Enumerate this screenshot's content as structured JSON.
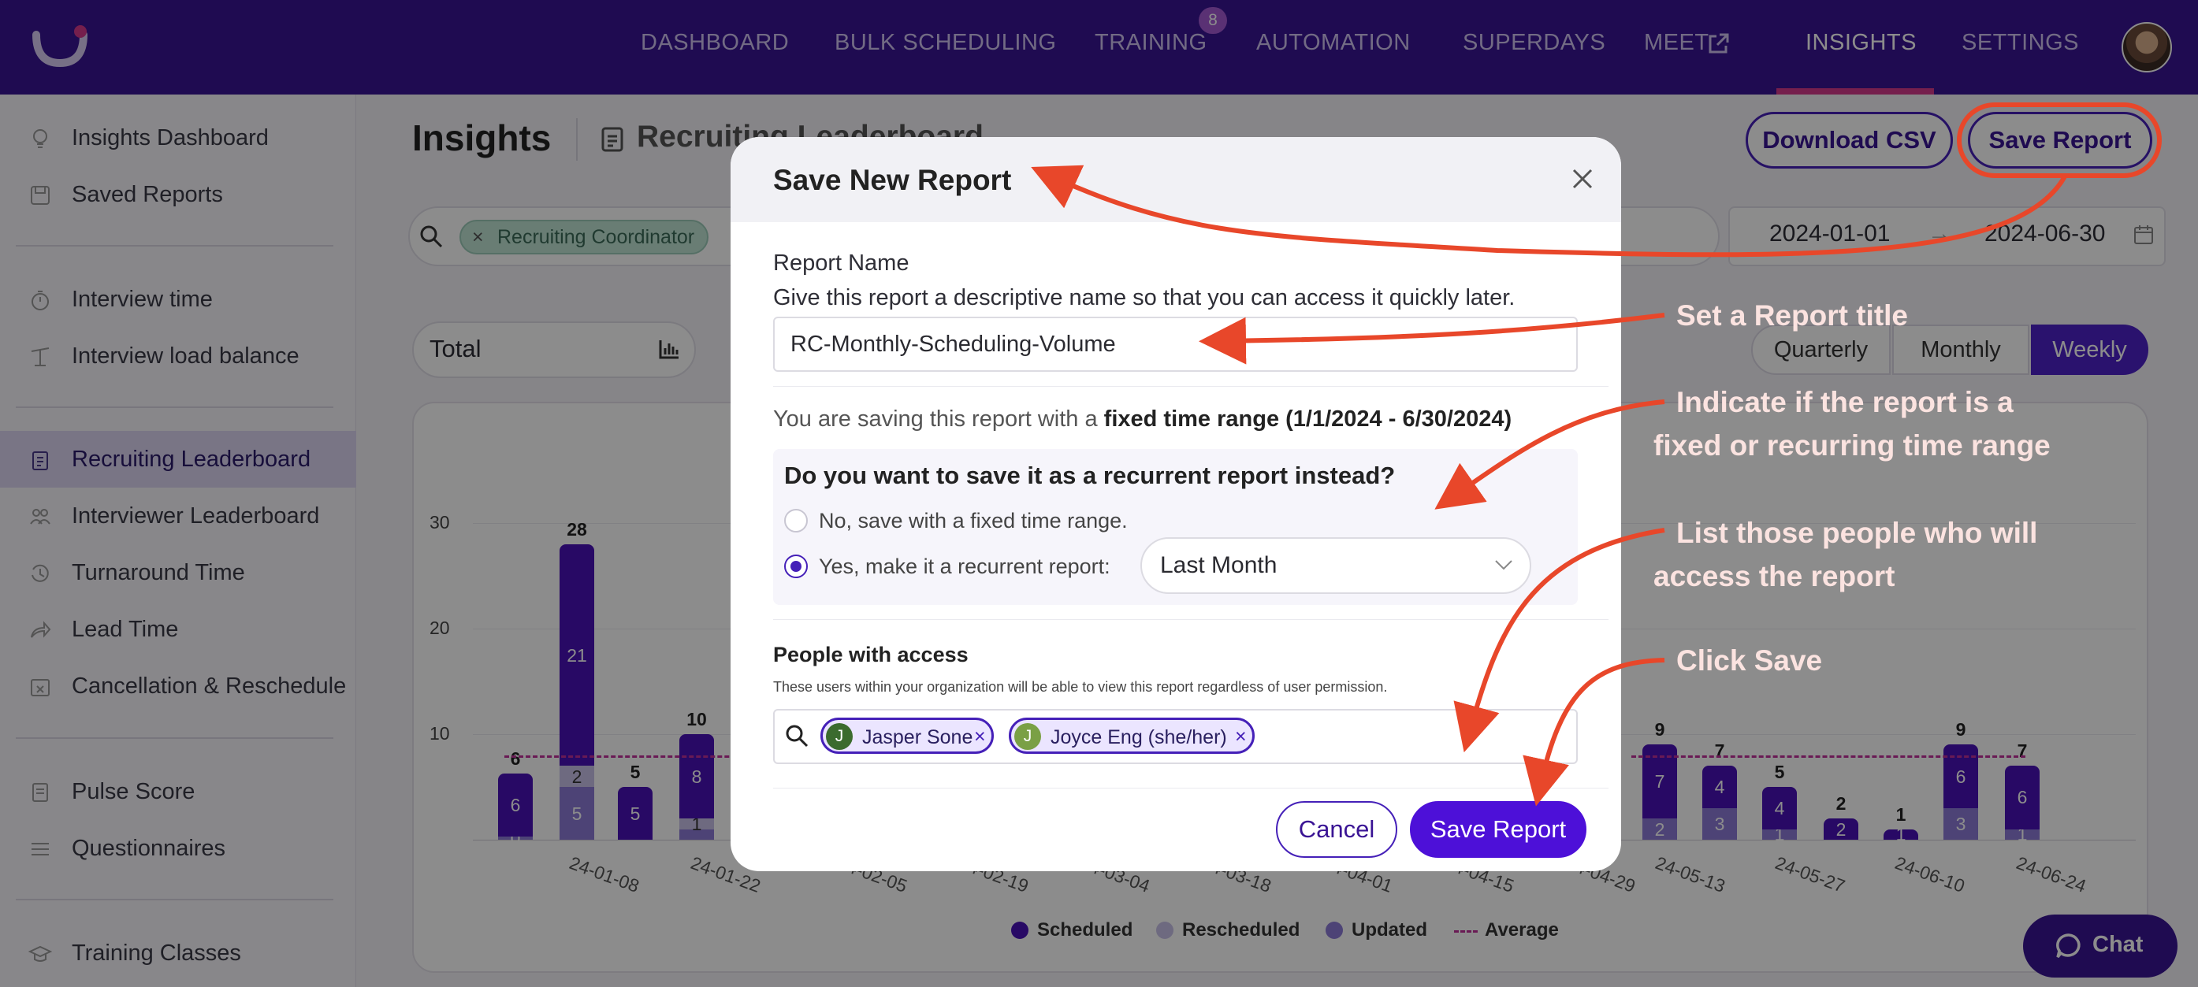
{
  "nav": {
    "items": [
      "DASHBOARD",
      "BULK SCHEDULING",
      "TRAINING",
      "AUTOMATION",
      "SUPERDAYS",
      "MEET",
      "INSIGHTS",
      "SETTINGS"
    ],
    "training_badge": "8"
  },
  "sidebar": {
    "items": [
      "Insights Dashboard",
      "Saved Reports",
      "Interview time",
      "Interview load balance",
      "Recruiting Leaderboard",
      "Interviewer Leaderboard",
      "Turnaround Time",
      "Lead Time",
      "Cancellation & Reschedule",
      "Pulse Score",
      "Questionnaires",
      "Training Classes"
    ]
  },
  "header": {
    "title": "Insights",
    "subtitle": "Recruiting Leaderboard",
    "download_csv": "Download CSV",
    "save_report": "Save Report"
  },
  "filters": {
    "chip": "Recruiting Coordinator",
    "date_start": "2024-01-01",
    "date_arrow": "→",
    "date_end": "2024-06-30"
  },
  "toolbar": {
    "total_label": "Total",
    "segments": [
      "Quarterly",
      "Monthly",
      "Weekly"
    ]
  },
  "chart_data": {
    "type": "bar",
    "stacked": true,
    "y_ticks": [
      "10",
      "20",
      "30"
    ],
    "ylim": [
      0,
      30
    ],
    "x_tick_labels": [
      "24-01-08",
      "24-01-22",
      "24-02-05",
      "24-02-19",
      "24-03-04",
      "24-03-18",
      "24-04-01",
      "24-04-15",
      "24-04-29",
      "24-05-13",
      "24-05-27",
      "24-06-10",
      "24-06-24"
    ],
    "bars": [
      {
        "total": "6",
        "segments": [
          {
            "series": "Scheduled",
            "value": 6,
            "label": "6"
          },
          {
            "series": "Updated",
            "value": 0.2,
            "label": "0"
          }
        ]
      },
      {
        "total": "28",
        "segments": [
          {
            "series": "Scheduled",
            "value": 21,
            "label": "21"
          },
          {
            "series": "Rescheduled",
            "value": 2,
            "label": "2"
          },
          {
            "series": "Updated",
            "value": 5,
            "label": "5"
          }
        ]
      },
      {
        "total": "5",
        "segments": [
          {
            "series": "Scheduled",
            "value": 5,
            "label": "5"
          }
        ]
      },
      {
        "total": "10",
        "segments": [
          {
            "series": "Scheduled",
            "value": 8,
            "label": "8"
          },
          {
            "series": "Rescheduled",
            "value": 1,
            "label": "1"
          },
          {
            "series": "Updated",
            "value": 1,
            "label": ""
          }
        ]
      },
      {
        "total": "9",
        "segments": [
          {
            "series": "Scheduled",
            "value": 7,
            "label": "7"
          },
          {
            "series": "Updated",
            "value": 2,
            "label": "2"
          }
        ]
      },
      {
        "total": "7",
        "segments": [
          {
            "series": "Scheduled",
            "value": 4,
            "label": "4"
          },
          {
            "series": "Updated",
            "value": 3,
            "label": "3"
          }
        ]
      },
      {
        "total": "5",
        "segments": [
          {
            "series": "Scheduled",
            "value": 4,
            "label": "4"
          },
          {
            "series": "Updated",
            "value": 1,
            "label": "1"
          }
        ]
      },
      {
        "total": "2",
        "segments": [
          {
            "series": "Scheduled",
            "value": 2,
            "label": "2"
          }
        ]
      },
      {
        "total": "1",
        "segments": [
          {
            "series": "Scheduled",
            "value": 1,
            "label": "1"
          }
        ]
      },
      {
        "total": "9",
        "segments": [
          {
            "series": "Scheduled",
            "value": 6,
            "label": "6"
          },
          {
            "series": "Updated",
            "value": 3,
            "label": "3"
          }
        ]
      },
      {
        "total": "7",
        "segments": [
          {
            "series": "Scheduled",
            "value": 6,
            "label": "6"
          },
          {
            "series": "Updated",
            "value": 1,
            "label": "1"
          }
        ]
      }
    ],
    "average": 8,
    "legend": [
      "Scheduled",
      "Rescheduled",
      "Updated",
      "Average"
    ],
    "colors": {
      "Scheduled": "#4a12b8",
      "Rescheduled": "#c9c2ea",
      "Updated": "#8d7ad8",
      "Average": "#c0309a"
    }
  },
  "modal": {
    "title": "Save New Report",
    "report_name_label": "Report Name",
    "report_name_help": "Give this report a descriptive name so that you can access it quickly later.",
    "report_name_value": "RC-Monthly-Scheduling-Volume",
    "fixed_prefix": "You are saving this report with a ",
    "fixed_bold": "fixed time range (1/1/2024 - 6/30/2024)",
    "recurrent_question": "Do you want to save it as a recurrent report instead?",
    "option_fixed": "No, save with a fixed time range.",
    "option_recurrent": "Yes, make it a recurrent report:",
    "recurrent_select": "Last Month",
    "people_label": "People with access",
    "people_help": "These users within your organization will be able to view this report regardless of user permission.",
    "people": [
      {
        "initial": "J",
        "name": "Jasper Sone",
        "color": "#3b6b2e"
      },
      {
        "initial": "J",
        "name": "Joyce Eng (she/her)",
        "color": "#7aa045"
      }
    ],
    "cancel": "Cancel",
    "save": "Save Report"
  },
  "annotations": {
    "set_title": "Set a Report title",
    "indicate_line1": "Indicate if the report is a",
    "indicate_line2": "fixed or recurring time range",
    "list_line1": "List those people who will",
    "list_line2": "access the report",
    "click_save": "Click Save",
    "color": "#e8472a"
  },
  "chat": {
    "label": "Chat"
  }
}
